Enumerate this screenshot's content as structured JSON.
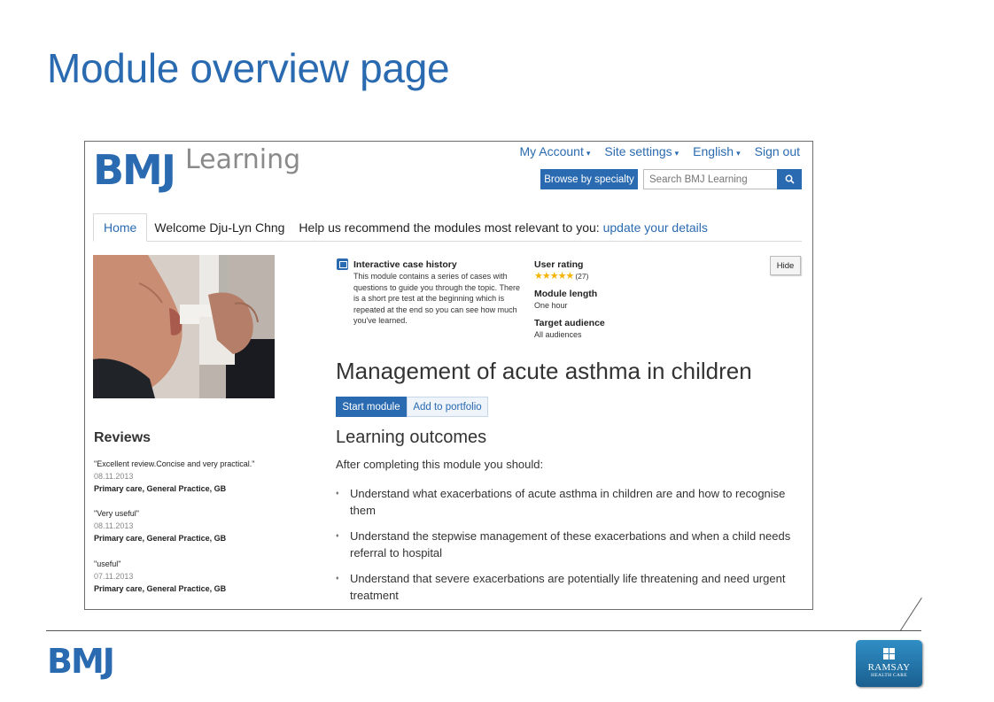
{
  "slide": {
    "title": "Module overview page",
    "footer_logo": "BMJ",
    "partner_logo": {
      "name": "RAMSAY",
      "sub": "HEALTH CARE"
    }
  },
  "site": {
    "logo_brand": "BMJ",
    "logo_product": "Learning",
    "top_links": [
      "My Account",
      "Site settings",
      "English",
      "Sign out"
    ],
    "browse_label": "Browse by specialty",
    "search_placeholder": "Search BMJ Learning",
    "search_button_icon": "search-icon"
  },
  "nav": {
    "home_tab": "Home",
    "welcome": "Welcome Dju-Lyn Chng",
    "help_text": "Help us recommend the modules most relevant to you: ",
    "help_link": "update your details"
  },
  "module": {
    "case_title": "Interactive case history",
    "case_desc": "This module contains a series of cases with questions to guide you through the topic. There is a short pre test at the beginning which is repeated at the end so you can see how much you've learned.",
    "rating_label": "User rating",
    "rating_stars": "★★★★★",
    "rating_count": "(27)",
    "rating_value": 5,
    "length_label": "Module length",
    "length_value": "One hour",
    "audience_label": "Target audience",
    "audience_value": "All audiences",
    "hide_label": "Hide",
    "title": "Management of acute asthma in children",
    "start_label": "Start module",
    "portfolio_label": "Add to portfolio"
  },
  "outcomes": {
    "title": "Learning outcomes",
    "intro": "After completing this module you should:",
    "items": [
      "Understand what exacerbations of acute asthma in children are and how to recognise them",
      "Understand the stepwise management of these exacerbations and when a child needs referral to hospital",
      "Understand that severe exacerbations are potentially life threatening and need urgent treatment"
    ]
  },
  "reviews": {
    "title": "Reviews",
    "items": [
      {
        "quote": "\"Excellent review.Concise and very practical.\"",
        "date": "08.11.2013",
        "source": "Primary care, General Practice, GB"
      },
      {
        "quote": "\"Very useful\"",
        "date": "08.11.2013",
        "source": "Primary care, General Practice, GB"
      },
      {
        "quote": "\"useful\"",
        "date": "07.11.2013",
        "source": "Primary care, General Practice, GB"
      }
    ]
  }
}
